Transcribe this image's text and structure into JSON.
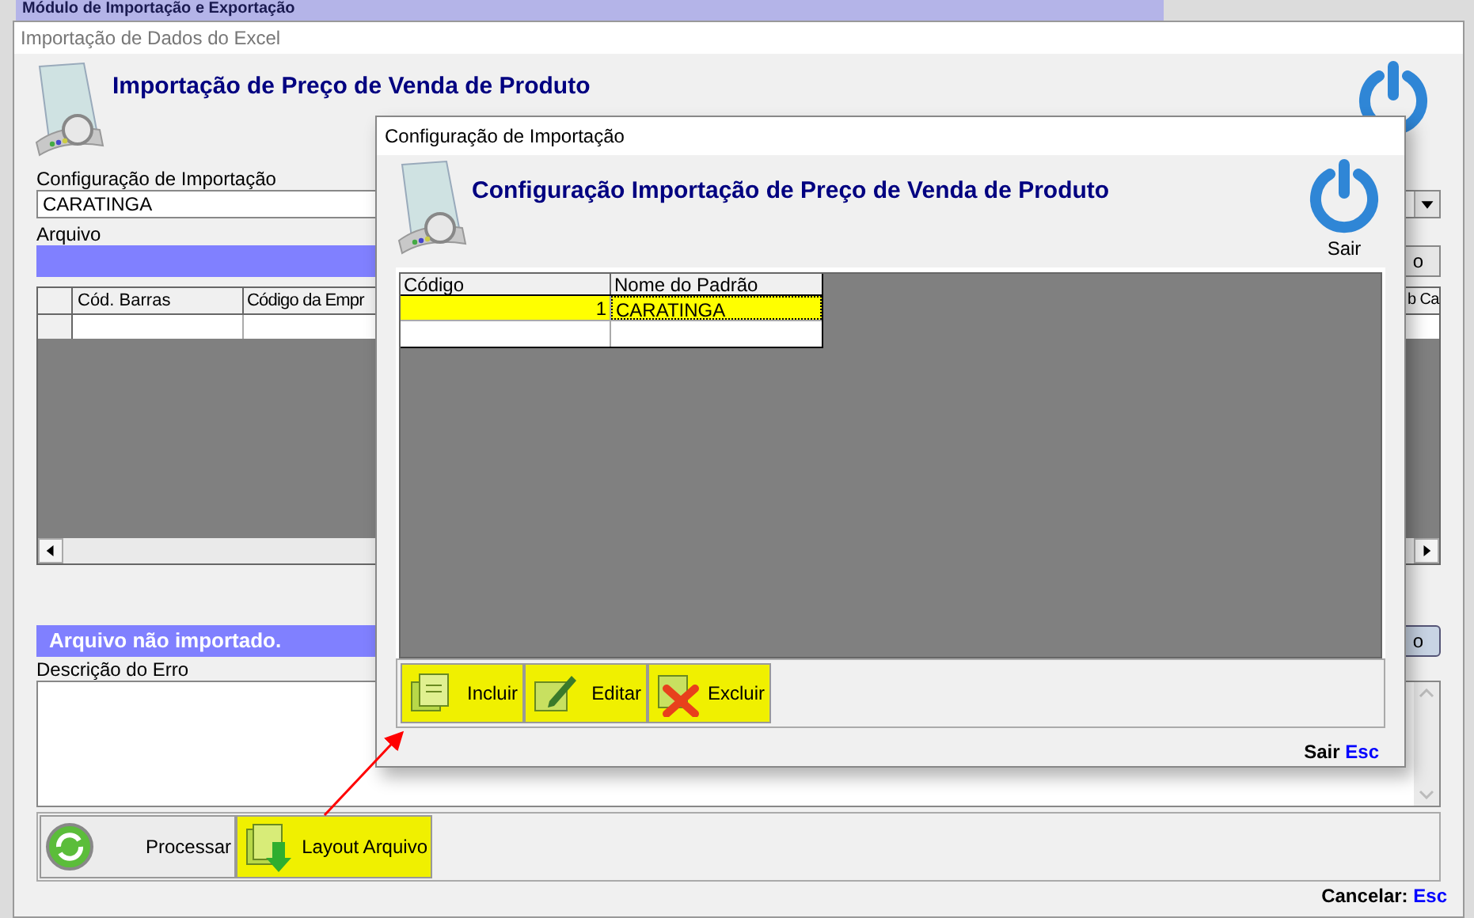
{
  "app_title": "Módulo de Importação e Exportação",
  "window": {
    "title": "Importação de Dados do Excel",
    "heading": "Importação de Preço de Venda de Produto",
    "config_label": "Configuração de Importação",
    "config_value": "CARATINGA",
    "file_label": "Arquivo",
    "file_button_fragment": "o",
    "table": {
      "columns": [
        "Cód. Barras",
        "Código da Empr",
        "b Ca"
      ]
    },
    "status": "Arquivo não importado.",
    "status_button_fragment": "o",
    "error_label": "Descrição do Erro",
    "toolbar": [
      {
        "label": "Processar",
        "kind": "process",
        "highlighted": false
      },
      {
        "label": "Layout Arquivo",
        "kind": "layout",
        "highlighted": true
      }
    ],
    "footer": {
      "label": "Cancelar:",
      "key": "Esc"
    }
  },
  "dialog": {
    "title": "Configuração de Importação",
    "heading": "Configuração Importação de Preço de Venda de Produto",
    "exit_label": "Sair",
    "table": {
      "columns": [
        "Código",
        "Nome do Padrão"
      ],
      "rows": [
        {
          "cells": [
            "1",
            "CARATINGA"
          ],
          "selected": true
        }
      ]
    },
    "buttons": [
      {
        "label": "Incluir",
        "kind": "add",
        "highlighted": true
      },
      {
        "label": "Editar",
        "kind": "edit",
        "highlighted": true
      },
      {
        "label": "Excluir",
        "kind": "delete",
        "highlighted": true
      }
    ],
    "footer": {
      "label": "Sair",
      "key": "Esc"
    }
  }
}
